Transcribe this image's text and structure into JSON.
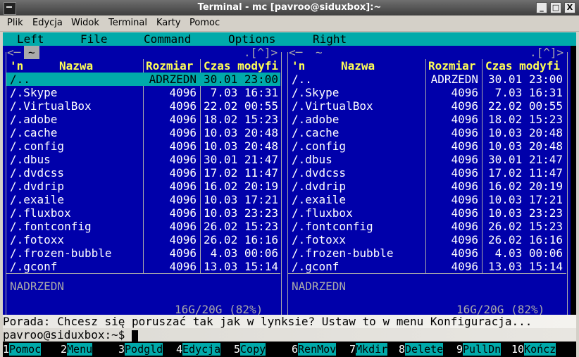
{
  "window": {
    "title": "Terminal - mc [pavroo@siduxbox]:~",
    "buttons": [
      "_",
      "□",
      "X"
    ]
  },
  "menubar": [
    "Plik",
    "Edycja",
    "Widok",
    "Terminal",
    "Karty",
    "Pomoc"
  ],
  "mc_menu": [
    "Left",
    "File",
    "Command",
    "Options",
    "Right"
  ],
  "left_panel": {
    "path": "~",
    "topright": ".[^]>",
    "headers": {
      "sort": "'n",
      "name": "Nazwa",
      "size": "Rozmiar",
      "time": "Czas modyfi"
    },
    "rows": [
      {
        "name": "/..",
        "size": "ADRZEDN",
        "time": "30.01 23:00"
      },
      {
        "name": "/.Skype",
        "size": "4096",
        "time": "7.03 16:31"
      },
      {
        "name": "/.VirtualBox",
        "size": "4096",
        "time": "22.02 00:55"
      },
      {
        "name": "/.adobe",
        "size": "4096",
        "time": "18.02 15:23"
      },
      {
        "name": "/.cache",
        "size": "4096",
        "time": "10.03 20:48"
      },
      {
        "name": "/.config",
        "size": "4096",
        "time": "10.03 20:48"
      },
      {
        "name": "/.dbus",
        "size": "4096",
        "time": "30.01 21:47"
      },
      {
        "name": "/.dvdcss",
        "size": "4096",
        "time": "17.02 11:47"
      },
      {
        "name": "/.dvdrip",
        "size": "4096",
        "time": "16.02 20:19"
      },
      {
        "name": "/.exaile",
        "size": "4096",
        "time": "10.03 17:21"
      },
      {
        "name": "/.fluxbox",
        "size": "4096",
        "time": "10.03 23:23"
      },
      {
        "name": "/.fontconfig",
        "size": "4096",
        "time": "26.02 15:23"
      },
      {
        "name": "/.fotoxx",
        "size": "4096",
        "time": "26.02 16:16"
      },
      {
        "name": "/.frozen-bubble",
        "size": "4096",
        "time": "4.03 00:06"
      },
      {
        "name": "/.gconf",
        "size": "4096",
        "time": "13.03 15:14"
      }
    ],
    "status": "NADRZEDN",
    "disk": "16G/20G (82%)"
  },
  "right_panel": {
    "path": "~",
    "topright": ".[^]>",
    "headers": {
      "sort": "'n",
      "name": "Nazwa",
      "size": "Rozmiar",
      "time": "Czas modyfi"
    },
    "rows": [
      {
        "name": "/..",
        "size": "ADRZEDN",
        "time": "30.01 23:00"
      },
      {
        "name": "/.Skype",
        "size": "4096",
        "time": "7.03 16:31"
      },
      {
        "name": "/.VirtualBox",
        "size": "4096",
        "time": "22.02 00:55"
      },
      {
        "name": "/.adobe",
        "size": "4096",
        "time": "18.02 15:23"
      },
      {
        "name": "/.cache",
        "size": "4096",
        "time": "10.03 20:48"
      },
      {
        "name": "/.config",
        "size": "4096",
        "time": "10.03 20:48"
      },
      {
        "name": "/.dbus",
        "size": "4096",
        "time": "30.01 21:47"
      },
      {
        "name": "/.dvdcss",
        "size": "4096",
        "time": "17.02 11:47"
      },
      {
        "name": "/.dvdrip",
        "size": "4096",
        "time": "16.02 20:19"
      },
      {
        "name": "/.exaile",
        "size": "4096",
        "time": "10.03 17:21"
      },
      {
        "name": "/.fluxbox",
        "size": "4096",
        "time": "10.03 23:23"
      },
      {
        "name": "/.fontconfig",
        "size": "4096",
        "time": "26.02 15:23"
      },
      {
        "name": "/.fotoxx",
        "size": "4096",
        "time": "26.02 16:16"
      },
      {
        "name": "/.frozen-bubble",
        "size": "4096",
        "time": "4.03 00:06"
      },
      {
        "name": "/.gconf",
        "size": "4096",
        "time": "13.03 15:14"
      }
    ],
    "status": "NADRZEDN",
    "disk": "16G/20G (82%)"
  },
  "hint": "Porada: Chcesz się poruszać tak jak w lynksie? Ustaw to w menu Konfiguracja...",
  "prompt": "pavroo@siduxbox:~$ ",
  "fkeys": [
    {
      "n": "1",
      "label": "Pomoc"
    },
    {
      "n": "2",
      "label": "Menu"
    },
    {
      "n": "3",
      "label": "Podgld"
    },
    {
      "n": "4",
      "label": "Edycja"
    },
    {
      "n": "5",
      "label": "Copy"
    },
    {
      "n": "6",
      "label": "RenMov"
    },
    {
      "n": "7",
      "label": "Mkdir"
    },
    {
      "n": "8",
      "label": "Delete"
    },
    {
      "n": "9",
      "label": "PullDn"
    },
    {
      "n": "10",
      "label": "Kończ"
    }
  ],
  "colors": {
    "panel_bg": "#0000aa",
    "accent": "#00aaaa",
    "header": "#ffff55"
  }
}
